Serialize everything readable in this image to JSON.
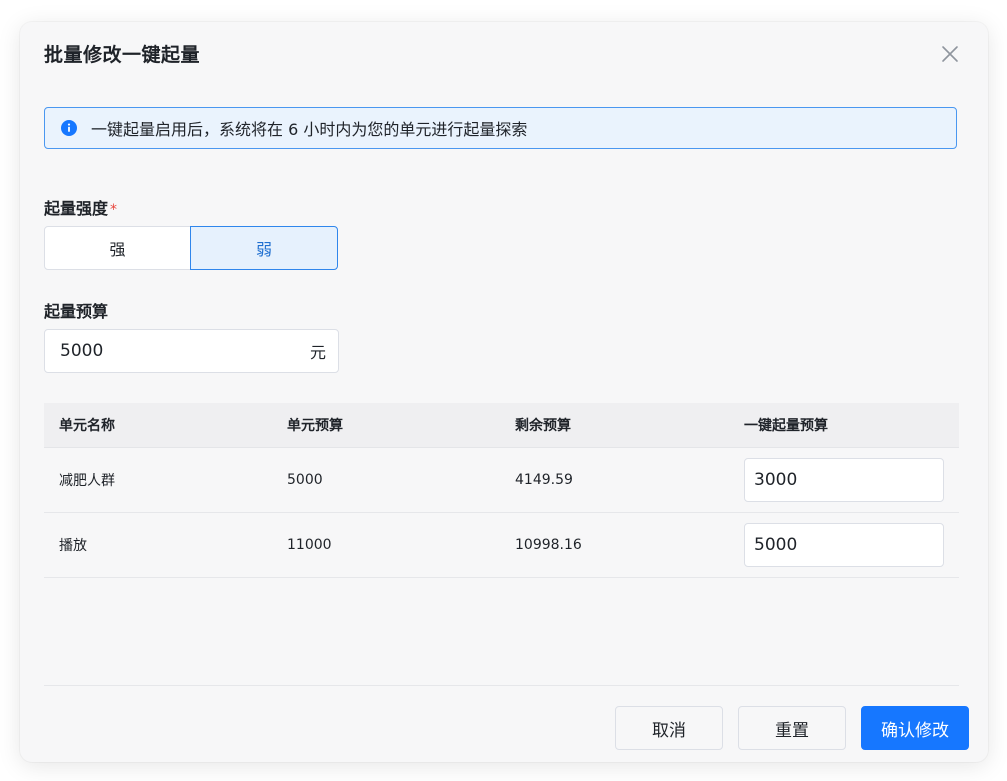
{
  "dialog": {
    "title": "批量修改一键起量",
    "close_icon": "close-icon"
  },
  "alert": {
    "icon": "info-icon",
    "text": "一键起量启用后，系统将在 6 小时内为您的单元进行起量探索",
    "accent_color": "#1677ff"
  },
  "intensity": {
    "label": "起量强度",
    "required_mark": "*",
    "options": [
      "强",
      "弱"
    ],
    "selected": "弱"
  },
  "budget": {
    "label": "起量预算",
    "value": "5000",
    "unit": "元"
  },
  "table": {
    "headers": [
      "单元名称",
      "单元预算",
      "剩余预算",
      "一键起量预算"
    ],
    "rows": [
      {
        "name": "减肥人群",
        "unit_budget": "5000",
        "remaining": "4149.59",
        "boost_budget": "3000"
      },
      {
        "name": "播放",
        "unit_budget": "11000",
        "remaining": "10998.16",
        "boost_budget": "5000"
      }
    ]
  },
  "footer": {
    "cancel_label": "取消",
    "reset_label": "重置",
    "confirm_label": "确认修改",
    "primary_color": "#1677ff"
  }
}
